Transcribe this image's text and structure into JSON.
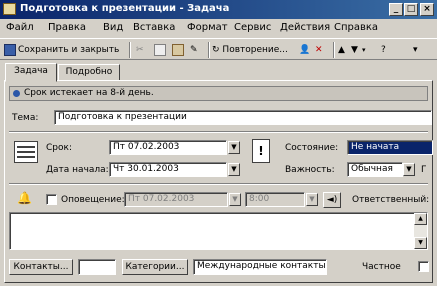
{
  "window": {
    "title": "Подготовка к презентации - Задача"
  },
  "window_controls": {
    "minimize": "_",
    "maximize": "□",
    "close": "×"
  },
  "menu": [
    "Файл",
    "Правка",
    "Вид",
    "Вставка",
    "Формат",
    "Сервис",
    "Действия",
    "Справка"
  ],
  "toolbar": {
    "save_close": "Сохранить и закрыть",
    "recurrence": "Повторение..."
  },
  "tabs": [
    "Задача",
    "Подробно"
  ],
  "info_banner": "Срок истекает на 8-й день.",
  "subject": {
    "label": "Тема:",
    "value": "Подготовка к презентации"
  },
  "due": {
    "label": "Срок:",
    "value": "Пт 07.02.2003"
  },
  "start": {
    "label": "Дата начала:",
    "value": "Чт 30.01.2003"
  },
  "status": {
    "label": "Состояние:",
    "value": "Не начата"
  },
  "priority": {
    "label": "Важность:",
    "value": "Обычная",
    "extra": "Г"
  },
  "reminder": {
    "label": "Оповещение:",
    "date": "Пт 07.02.2003",
    "time": "8:00",
    "owner_label": "Ответственный:"
  },
  "bottom": {
    "contacts_button": "Контакты...",
    "categories_button": "Категории...",
    "categories_value": "Международные контакты",
    "private_label": "Частное"
  }
}
